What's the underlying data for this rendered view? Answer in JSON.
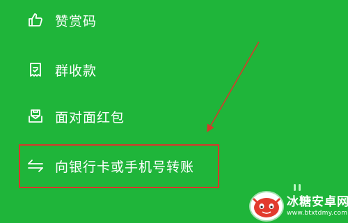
{
  "menu": {
    "items": [
      {
        "label": "赞赏码",
        "icon": "thumbs-up-icon"
      },
      {
        "label": "群收款",
        "icon": "receipt-icon"
      },
      {
        "label": "面对面红包",
        "icon": "red-packet-icon"
      },
      {
        "label": "向银行卡或手机号转账",
        "icon": "transfer-arrows-icon"
      }
    ]
  },
  "annotation": {
    "highlight_color": "#d9362b",
    "target": "向银行卡或手机号转账"
  },
  "watermark": {
    "title": "冰糖安卓网",
    "url": "www.btxtdmy.com"
  },
  "colors": {
    "background": "#1fb53a",
    "text": "#ffffff"
  }
}
